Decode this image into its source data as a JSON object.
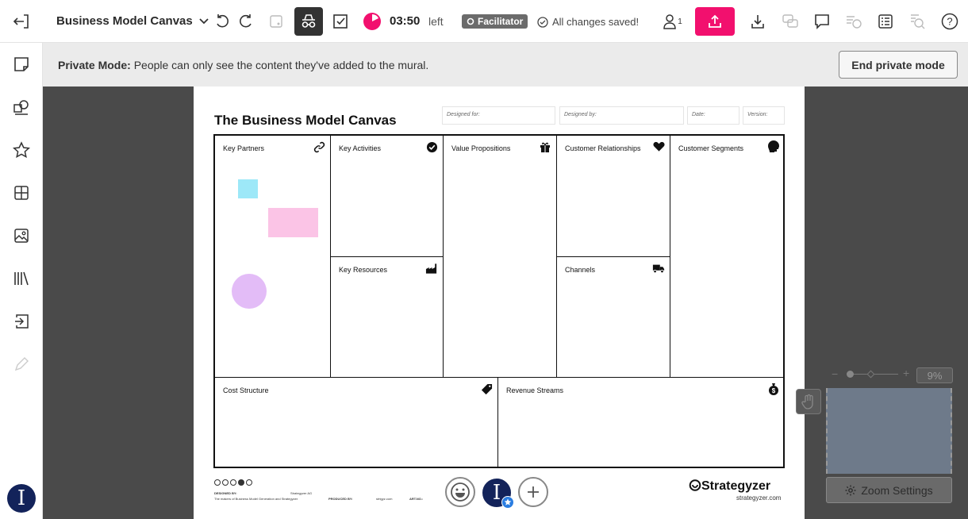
{
  "topbar": {
    "board_title": "Business Model Canvas",
    "timer": "03:50",
    "timer_suffix": "left",
    "role_badge": "Facilitator",
    "save_status": "All changes saved!",
    "participants_count": "1"
  },
  "banner": {
    "label": "Private Mode:",
    "message": "People can only see the content they've added to the mural.",
    "end_button": "End private mode"
  },
  "sidebar": {
    "avatar_initial": "I"
  },
  "canvas": {
    "title": "The Business Model Canvas",
    "fields": [
      "Designed for:",
      "Designed by:",
      "Date:",
      "Version:"
    ],
    "blocks": {
      "key_partners": "Key Partners",
      "key_activities": "Key Activities",
      "key_resources": "Key Resources",
      "value_propositions": "Value Propositions",
      "customer_relationships": "Customer Relationships",
      "channels": "Channels",
      "customer_segments": "Customer Segments",
      "cost_structure": "Cost Structure",
      "revenue_streams": "Revenue Streams"
    },
    "footer": {
      "designed_by_label": "DESIGNED BY:",
      "designed_by_value": "Strategyzer AG",
      "makers_note": "The makers of Business Model Generation and Strategyzer",
      "produced_by_label": "PRODUCED BY:",
      "url_small": "strtgyz.com",
      "art_no_label": "ART.NO.:",
      "logo": "Strategyzer",
      "logo_url": "strategyzer.com"
    },
    "reaction_avatar_initial": "I"
  },
  "zoom": {
    "percent": "9%",
    "settings_label": "Zoom Settings"
  },
  "colors": {
    "accent": "#f2106e",
    "sticky_blue": "#9de8f8",
    "sticky_pink": "#fbc4e6",
    "circle_purple": "#e3bcf7",
    "avatar": "#13235a"
  }
}
